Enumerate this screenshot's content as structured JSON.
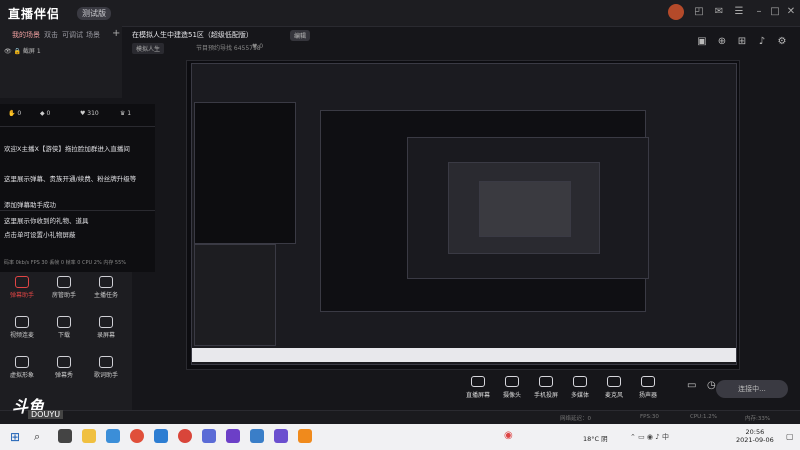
{
  "app": {
    "title": "直播伴侣",
    "version": "测试版"
  },
  "left_tabs": [
    "我的场景",
    "双击",
    "可调试",
    "场景"
  ],
  "scene": {
    "item": "截屏 1"
  },
  "stats": [
    {
      "icon": "hand-icon",
      "value": "0"
    },
    {
      "icon": "gift-icon",
      "value": "0"
    },
    {
      "icon": "heart-icon",
      "value": "310"
    },
    {
      "icon": "crown-icon",
      "value": "1"
    }
  ],
  "chat": [
    "欢迎X主播X【游侠】拖拉脸加群进入直播间",
    "这里展示弹幕、贵族开通/续费、粉丝牌升级等",
    "添加弹幕助手成功",
    "这里展示你收到的礼物、道具",
    "点击单可设置小礼物屏蔽"
  ],
  "chat_footer": "码率 0kb/s  FPS 30  丢帧 0  帧率 0  CPU 2%  内存 55%",
  "tools": [
    {
      "label": "弹幕助手",
      "icon": "danmaku-icon",
      "active": true
    },
    {
      "label": "房管助手",
      "icon": "admin-icon",
      "active": false
    },
    {
      "label": "主播任务",
      "icon": "task-icon",
      "active": false
    },
    {
      "label": "视频连麦",
      "icon": "link-icon",
      "active": false
    },
    {
      "label": "下载",
      "icon": "download-icon",
      "active": false
    },
    {
      "label": "录屏幕",
      "icon": "record-icon",
      "active": false
    },
    {
      "label": "虚拟形象",
      "icon": "avatar-icon",
      "active": false
    },
    {
      "label": "弹幕秀",
      "icon": "show-icon",
      "active": false
    },
    {
      "label": "歌词助手",
      "icon": "lyric-icon",
      "active": false
    }
  ],
  "room": {
    "title": "在模拟人生中建造51区（超级低配版）",
    "tag": "编辑",
    "category": "模拟人生",
    "id": "节目预约导找 6455798",
    "likes": "0"
  },
  "bottom_buttons": [
    "直播屏幕",
    "摄像头",
    "手机投屏",
    "多媒体",
    "麦克风",
    "扬声器"
  ],
  "live_button": "连接中...",
  "status": {
    "left": "网络延迟：0",
    "fps": "FPS:30",
    "cpu": "CPU:1.2%",
    "mem": "内存:33%"
  },
  "watermark": {
    "main": "斗鱼",
    "sub": "DOUYU"
  },
  "taskbar": {
    "weather": "18°C 阴",
    "time": "20:56",
    "date": "2021-09-06"
  }
}
